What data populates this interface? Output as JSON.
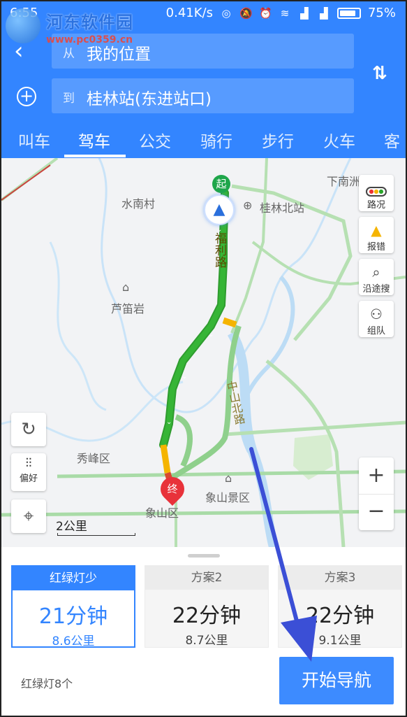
{
  "statusbar": {
    "time": "6:55",
    "network_speed": "0.41K/s",
    "battery": "75%"
  },
  "watermark": {
    "title": "河东软件园",
    "url": "www.pc0359.cn"
  },
  "route": {
    "from_prefix": "从",
    "from_value": "我的位置",
    "to_prefix": "到",
    "to_value": "桂林站(东进站口)"
  },
  "tabs": [
    {
      "label": "叫车"
    },
    {
      "label": "驾车"
    },
    {
      "label": "公交"
    },
    {
      "label": "骑行"
    },
    {
      "label": "步行"
    },
    {
      "label": "火车"
    },
    {
      "label": "客"
    }
  ],
  "active_tab": "驾车",
  "map": {
    "labels": {
      "xiananshan": "下南洲",
      "shuinancun": "水南村",
      "guilin_north": "桂林北站",
      "ludiyan": "芦笛岩",
      "xiufeng": "秀峰区",
      "xiangshan_scenic": "象山景区",
      "xiangshan": "象山区",
      "fuli_road": "福利路",
      "zhongshan_north": "中山北路"
    },
    "markers": {
      "start": "起",
      "end": "终"
    },
    "side_buttons": {
      "traffic": "路况",
      "report": "报错",
      "search_along": "沿途搜",
      "team": "组队"
    },
    "preference": "偏好",
    "zoom_in": "+",
    "zoom_out": "−",
    "scale": "2公里"
  },
  "plans": [
    {
      "name": "红绿灯少",
      "time": "21分钟",
      "distance": "8.6公里"
    },
    {
      "name": "方案2",
      "time": "22分钟",
      "distance": "8.7公里"
    },
    {
      "name": "方案3",
      "time": "22分钟",
      "distance": "9.1公里"
    }
  ],
  "lights_info": "红绿灯8个",
  "start_button": "开始导航",
  "colors": {
    "brand_blue": "#3385ff",
    "route_green": "#2aa52a",
    "route_slow": "#f5b400",
    "annotation_arrow": "#3b4fd6"
  }
}
